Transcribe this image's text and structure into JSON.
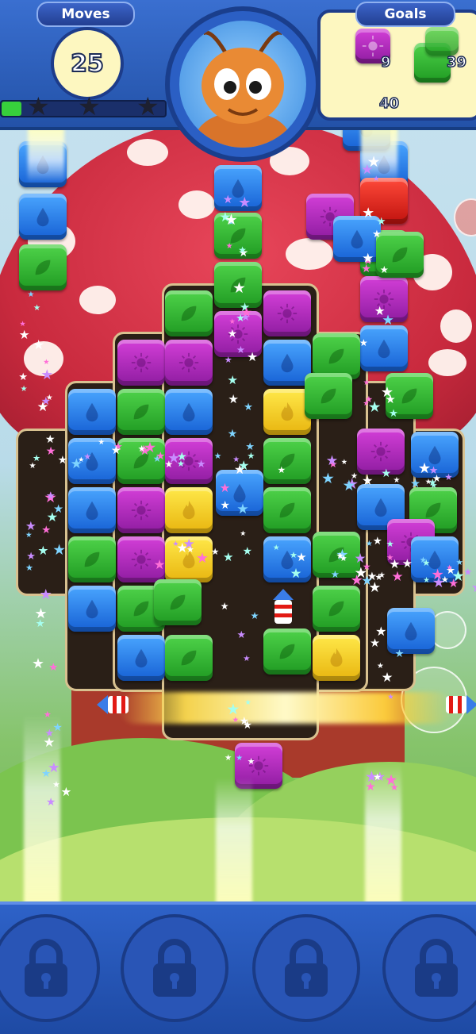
{
  "hud": {
    "moves_label": "Moves",
    "moves_value": "25",
    "goals_label": "Goals",
    "progress_fraction": 0.12,
    "stars_total": 3,
    "stars_earned": 0
  },
  "goals": [
    {
      "tile": "purple",
      "icon": "sun-icon",
      "count": "9"
    },
    {
      "tile": "green",
      "icon": "leaf-icon",
      "count": "39"
    },
    {
      "tile": "blue",
      "icon": "droplet-icon",
      "count": "40"
    }
  ],
  "boosters": [
    {
      "name": "booster-slot-1",
      "locked": true,
      "icon": "lock-icon"
    },
    {
      "name": "booster-slot-2",
      "locked": true,
      "icon": "lock-icon"
    },
    {
      "name": "booster-slot-3",
      "locked": true,
      "icon": "lock-icon"
    },
    {
      "name": "booster-slot-4",
      "locked": true,
      "icon": "lock-icon"
    }
  ],
  "colors": {
    "green": "#2fb82f",
    "purple": "#b22ec0",
    "blue": "#2c7ce8",
    "yellow": "#f7cf1f",
    "red": "#e21a14",
    "hud_blue": "#2352a8"
  }
}
